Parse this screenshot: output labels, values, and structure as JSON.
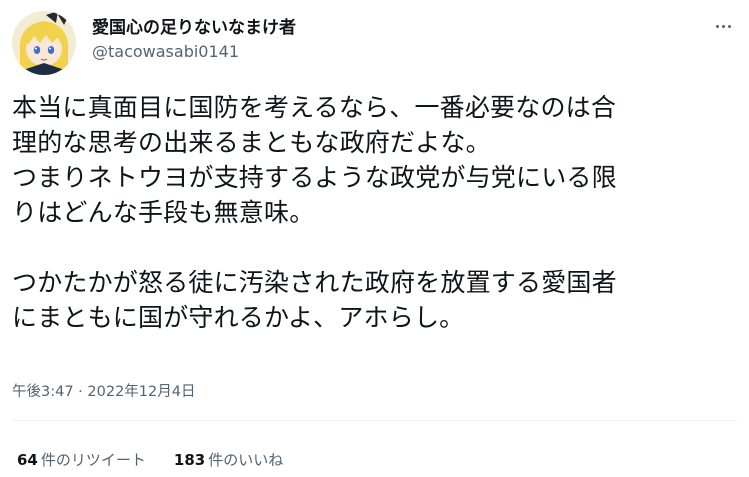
{
  "user": {
    "display_name": "愛国心の足りないなまけ者",
    "handle": "@tacowasabi0141"
  },
  "tweet": {
    "text": "本当に真面目に国防を考えるなら、一番必要なのは合\n理的な思考の出来るまともな政府だよな。\nつまりネトウヨが支持するような政党が与党にいる限\nりはどんな手段も無意味。\n\nつかたかが怒る徒に汚染された政府を放置する愛国者\nにまともに国が守れるかよ、アホらし。",
    "timestamp": "午後3:47 · 2022年12月4日"
  },
  "stats": {
    "retweets_count": "64",
    "retweets_label": "件のリツイート",
    "likes_count": "183",
    "likes_label": "件のいいね"
  },
  "icons": {
    "more": "more-icon",
    "avatar": "anime-character-avatar"
  }
}
